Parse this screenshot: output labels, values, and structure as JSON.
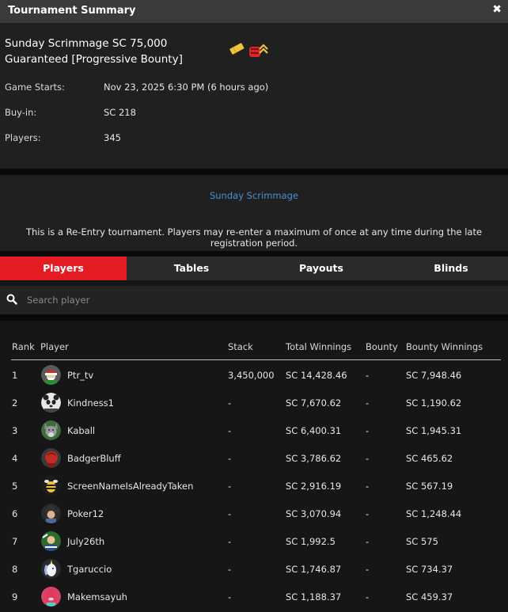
{
  "window": {
    "title": "Tournament Summary",
    "close_glyph": "✖"
  },
  "summary": {
    "name": "Sunday Scrimmage SC 75,000 Guaranteed [Progressive Bounty]",
    "badges": [
      "ticket-icon",
      "bounty-icon"
    ],
    "info": [
      {
        "label": "Game Starts:",
        "value": "Nov 23, 2025 6:30 PM (6 hours ago)"
      },
      {
        "label": "Buy-in:",
        "value": "SC 218"
      },
      {
        "label": "Players:",
        "value": "345"
      }
    ]
  },
  "description": {
    "link": "Sunday Scrimmage",
    "note": "This is a Re-Entry tournament. Players may re-enter a maximum of once at any time during the late registration period."
  },
  "tabs": [
    {
      "label": "Players",
      "active": true
    },
    {
      "label": "Tables",
      "active": false
    },
    {
      "label": "Payouts",
      "active": false
    },
    {
      "label": "Blinds",
      "active": false
    }
  ],
  "search": {
    "placeholder": "Search player",
    "value": ""
  },
  "table": {
    "headers": {
      "rank": "Rank",
      "player": "Player",
      "stack": "Stack",
      "total_winnings": "Total Winnings",
      "bounty": "Bounty",
      "bounty_winnings": "Bounty Winnings"
    },
    "rows": [
      {
        "rank": "1",
        "player": "Ptr_tv",
        "stack": "3,450,000",
        "total_winnings": "SC 14,428.46",
        "bounty": "-",
        "bounty_winnings": "SC 7,948.46",
        "avatar": "santa-avatar"
      },
      {
        "rank": "2",
        "player": "Kindness1",
        "stack": "-",
        "total_winnings": "SC 7,670.62",
        "bounty": "-",
        "bounty_winnings": "SC 1,190.62",
        "avatar": "panda-avatar"
      },
      {
        "rank": "3",
        "player": "Kaball",
        "stack": "-",
        "total_winnings": "SC 6,400.31",
        "bounty": "-",
        "bounty_winnings": "SC 1,945.31",
        "avatar": "wolf-avatar"
      },
      {
        "rank": "4",
        "player": "BadgerBluff",
        "stack": "-",
        "total_winnings": "SC 3,786.62",
        "bounty": "-",
        "bounty_winnings": "SC 465.62",
        "avatar": "boxer-avatar"
      },
      {
        "rank": "5",
        "player": "ScreenNameIsAlreadyTaken",
        "stack": "-",
        "total_winnings": "SC 2,916.19",
        "bounty": "-",
        "bounty_winnings": "SC 567.19",
        "avatar": "bee-avatar"
      },
      {
        "rank": "6",
        "player": "Poker12",
        "stack": "-",
        "total_winnings": "SC 3,070.94",
        "bounty": "-",
        "bounty_winnings": "SC 1,248.44",
        "avatar": "cowboy-avatar"
      },
      {
        "rank": "7",
        "player": "July26th",
        "stack": "-",
        "total_winnings": "SC 1,992.5",
        "bounty": "-",
        "bounty_winnings": "SC 575",
        "avatar": "rugby-avatar"
      },
      {
        "rank": "8",
        "player": "Tgaruccio",
        "stack": "-",
        "total_winnings": "SC 1,746.87",
        "bounty": "-",
        "bounty_winnings": "SC 734.37",
        "avatar": "unicorn-avatar"
      },
      {
        "rank": "9",
        "player": "Makemsayuh",
        "stack": "-",
        "total_winnings": "SC 1,188.37",
        "bounty": "-",
        "bounty_winnings": "SC 459.37",
        "avatar": "mermaid-avatar"
      }
    ]
  },
  "colors": {
    "accent": "#e31b23",
    "link": "#4a90d9",
    "panel": "#202020",
    "background": "#161616"
  }
}
